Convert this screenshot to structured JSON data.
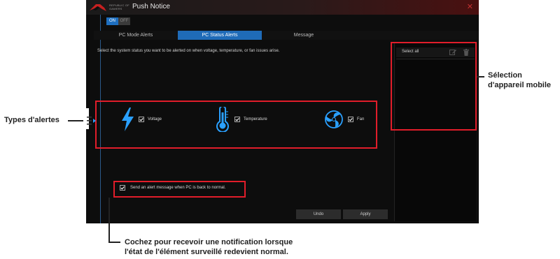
{
  "window": {
    "brand": "REPUBLIC OF\nGAMERS",
    "title": "Push Notice",
    "close_glyph": "✕"
  },
  "toggle": {
    "on_label": "ON",
    "off_label": "OFF",
    "selected": "ON"
  },
  "tabs": [
    {
      "label": "PC Mode Alerts",
      "active": false
    },
    {
      "label": "PC Status Alerts",
      "active": true
    },
    {
      "label": "Message",
      "active": false
    }
  ],
  "instruction": "Select the system status you want to be alerted on when voltage, temperature, or fan issues arise.",
  "alerts": [
    {
      "label": "Voltage",
      "icon": "lightning-icon",
      "checked": true
    },
    {
      "label": "Temperature",
      "icon": "thermometer-icon",
      "checked": true
    },
    {
      "label": "Fan",
      "icon": "fan-icon",
      "checked": true
    }
  ],
  "notify_back_to_normal": {
    "label": "Send an alert message when PC is back to normal.",
    "checked": true
  },
  "device_panel": {
    "select_all_label": "Select all",
    "edit_icon": "edit-icon",
    "delete_icon": "trash-icon"
  },
  "buttons": {
    "undo": "Undo",
    "apply": "Apply"
  },
  "annotations": {
    "alert_types": "Types d'alertes",
    "device_selection_line1": "Sélection",
    "device_selection_line2": "d'appareil mobile",
    "notify_line1": "Cochez pour recevoir une notification lorsque",
    "notify_line2": "l'état de l'élément surveillé redevient normal."
  },
  "colors": {
    "accent_blue": "#1f6bb8",
    "icon_blue": "#2aa0ff",
    "highlight_red": "#e11d2a",
    "window_bg": "#0d0d0d"
  }
}
